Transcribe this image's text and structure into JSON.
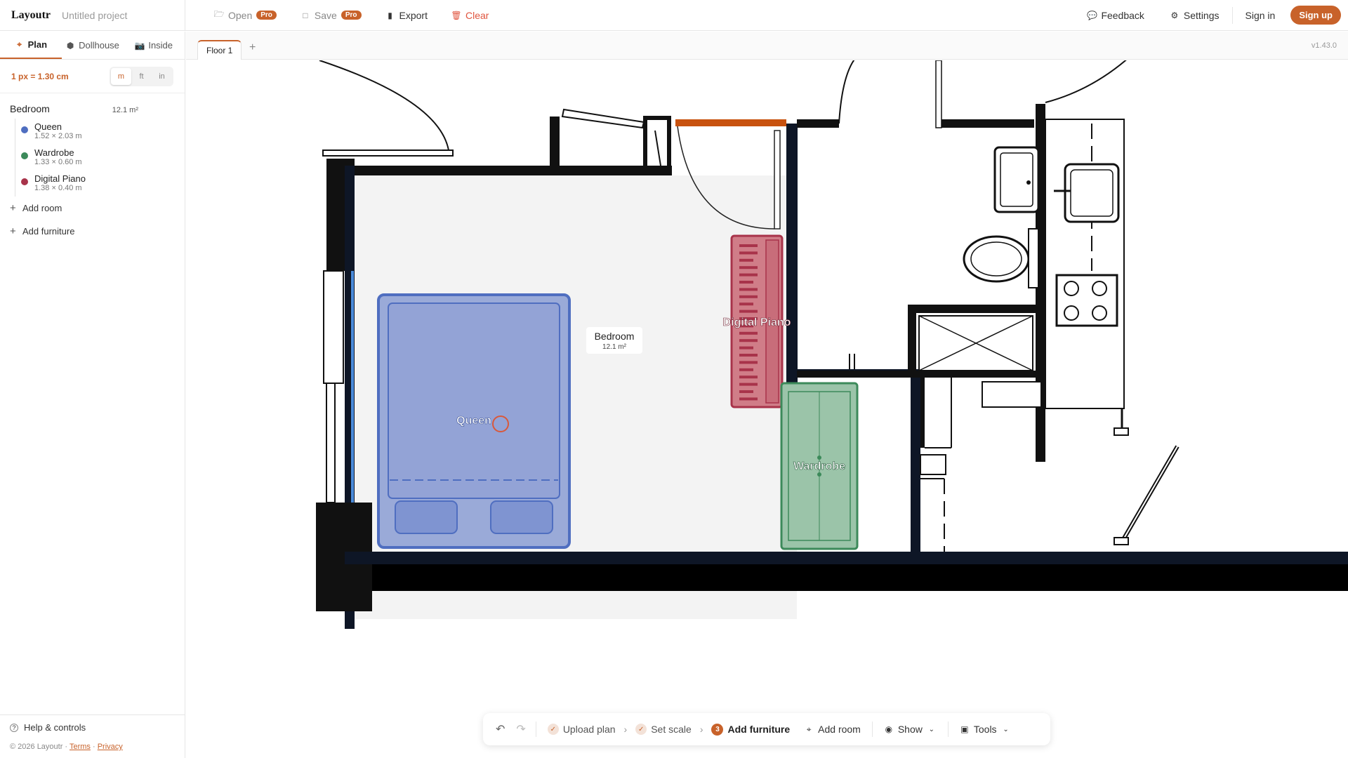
{
  "app": {
    "logo": "Layoutr",
    "project": "Untitled project",
    "version": "v1.43.0"
  },
  "menu": {
    "open": "Open",
    "save": "Save",
    "pro_badge": "Pro",
    "export": "Export",
    "clear": "Clear",
    "feedback": "Feedback",
    "settings": "Settings",
    "signin": "Sign in",
    "signup": "Sign up"
  },
  "view_tabs": [
    "Plan",
    "Dollhouse",
    "Inside"
  ],
  "scale": {
    "text": "1 px = 1.30 cm",
    "units": [
      "m",
      "ft",
      "in"
    ],
    "selected": "m"
  },
  "room": {
    "name": "Bedroom",
    "area": "12.1 m²",
    "items": [
      {
        "name": "Queen",
        "dims": "1.52 × 2.03 m",
        "color": "#4f6ec0"
      },
      {
        "name": "Wardrobe",
        "dims": "1.33 × 0.60 m",
        "color": "#3c8a5a"
      },
      {
        "name": "Digital Piano",
        "dims": "1.38 × 0.40 m",
        "color": "#a8334a"
      }
    ]
  },
  "actions": {
    "add_room": "Add room",
    "add_furniture": "Add furniture"
  },
  "footer": {
    "help": "Help & controls",
    "copyright": "© 2026 Layoutr ·",
    "terms": "Terms",
    "privacy": "Privacy"
  },
  "floor": {
    "tab": "Floor 1",
    "add": "+"
  },
  "canvas_labels": {
    "room_name": "Bedroom",
    "room_area": "12.1 m²",
    "bed": "Queen",
    "piano": "Digital Piano",
    "wardrobe": "Wardrobe"
  },
  "toolbar": {
    "upload": "Upload plan",
    "set_scale": "Set scale",
    "step_num": "3",
    "add_furniture": "Add furniture",
    "add_room": "Add room",
    "show": "Show",
    "tools": "Tools"
  },
  "colors": {
    "accent": "#c8622a",
    "bed": "#4f6ec0",
    "wardrobe": "#3c8a5a",
    "piano": "#a8334a"
  }
}
